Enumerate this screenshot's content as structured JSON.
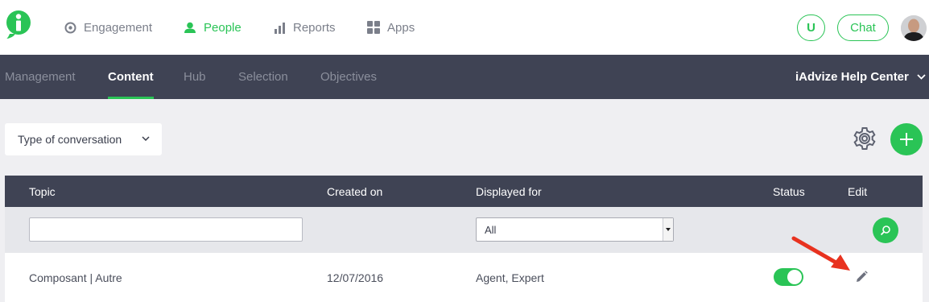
{
  "topnav": {
    "items": [
      {
        "label": "Engagement",
        "icon": "target-icon",
        "active": false
      },
      {
        "label": "People",
        "icon": "person-icon",
        "active": true
      },
      {
        "label": "Reports",
        "icon": "bar-chart-icon",
        "active": false
      },
      {
        "label": "Apps",
        "icon": "grid-icon",
        "active": false
      }
    ],
    "u_label": "U",
    "chat_label": "Chat"
  },
  "subnav": {
    "tabs": [
      "Management",
      "Content",
      "Hub",
      "Selection",
      "Objectives"
    ],
    "active_tab": "Content",
    "help_center": "iAdvize Help Center"
  },
  "filter": {
    "label": "Type of conversation"
  },
  "table": {
    "columns": [
      "Topic",
      "Created on",
      "Displayed for",
      "Status",
      "Edit"
    ],
    "displayed_for_filter": "All",
    "rows": [
      {
        "topic": "Composant | Autre",
        "created_on": "12/07/2016",
        "displayed_for": "Agent, Expert",
        "status": true
      }
    ]
  },
  "colors": {
    "accent": "#2ac456",
    "nav_dark": "#3f4354",
    "annotation_arrow": "#e8321f"
  }
}
